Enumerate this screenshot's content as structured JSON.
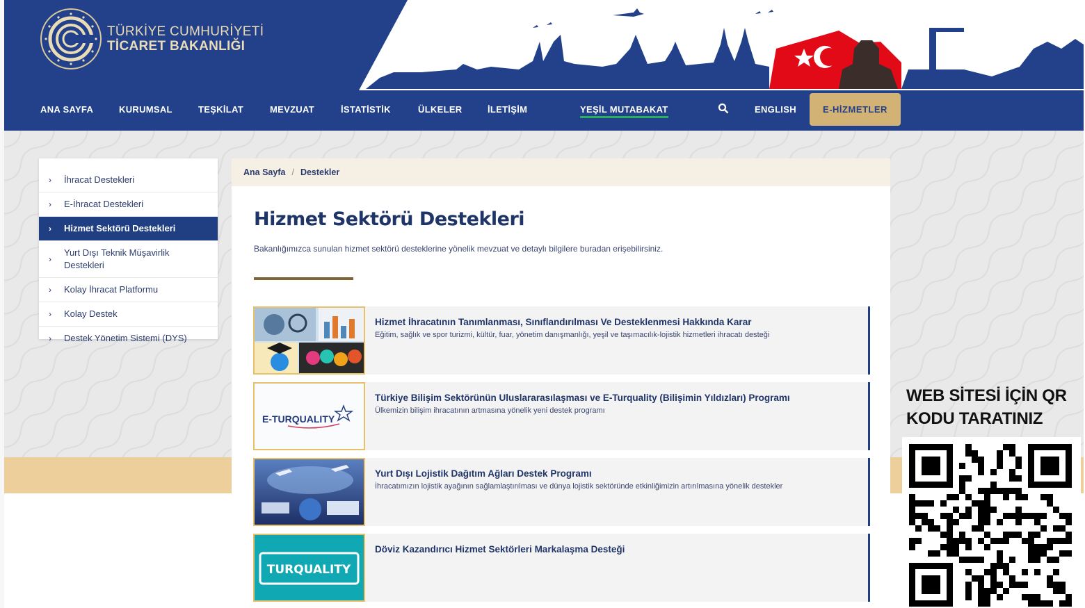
{
  "logo": {
    "line1": "TÜRKİYE CUMHURİYETİ",
    "line2": "TİCARET BAKANLIĞI"
  },
  "nav": {
    "items": [
      "ANA SAYFA",
      "KURUMSAL",
      "TEŞKİLAT",
      "MEVZUAT",
      "İSTATİSTİK",
      "ÜLKELER",
      "İLETİŞİM"
    ],
    "green_item": "YEŞİL MUTABAKAT",
    "english": "ENGLISH",
    "ehizmetler": "E-HİZMETLER",
    "search_icon": "search-icon"
  },
  "sidebar": {
    "items": [
      {
        "label": "İhracat Destekleri"
      },
      {
        "label": "E-İhracat Destekleri"
      },
      {
        "label": "Hizmet Sektörü Destekleri",
        "active": true
      },
      {
        "label": "Yurt Dışı Teknik Müşavirlik Destekleri"
      },
      {
        "label": "Kolay İhracat Platformu"
      },
      {
        "label": "Kolay Destek"
      },
      {
        "label": "Destek Yönetim Sistemi (DYS)"
      }
    ]
  },
  "breadcrumb": {
    "home": "Ana Sayfa",
    "separator": "/",
    "current": "Destekler"
  },
  "main": {
    "title": "Hizmet Sektörü Destekleri",
    "description": "Bakanlığımızca sunulan hizmet sektörü desteklerine yönelik mevzuat ve detaylı bilgilere buradan erişebilirsiniz.",
    "cards": [
      {
        "title": "Hizmet İhracatının Tanımlanması, Sınıflandırılması Ve Desteklenmesi Hakkında Karar",
        "subtitle": "Eğitim, sağlık ve spor turizmi, kültür, fuar, yönetim danışmanlığı, yeşil ve taşımacılık-lojistik hizmetleri ihracatı desteği"
      },
      {
        "title": "Türkiye Bilişim Sektörünün Uluslararasılaşması ve E-Turquality (Bilişimin Yıldızları) Programı",
        "subtitle": "Ülkemizin bilişim ihracatının artmasına yönelik yeni destek programı",
        "logo_text": "E-TURQUALITY"
      },
      {
        "title": "Yurt Dışı Lojistik Dağıtım Ağları Destek Programı",
        "subtitle": "İhracatımızın lojistik ayağının sağlamlaştırılması ve dünya lojistik sektöründe etkinliğimizin artırılmasına yönelik destekler"
      },
      {
        "title": "Döviz Kazandırıcı Hizmet Sektörleri Markalaşma Desteği",
        "subtitle": "",
        "logo_text": "TURQUALITY"
      }
    ]
  },
  "qr": {
    "caption_line1": "WEB SİTESİ İÇİN QR",
    "caption_line2": "KODU TARATINIZ"
  },
  "colors": {
    "navy": "#22418a",
    "gold": "#d2b275",
    "green": "#27b15d",
    "accent_rule": "#7c6434"
  }
}
